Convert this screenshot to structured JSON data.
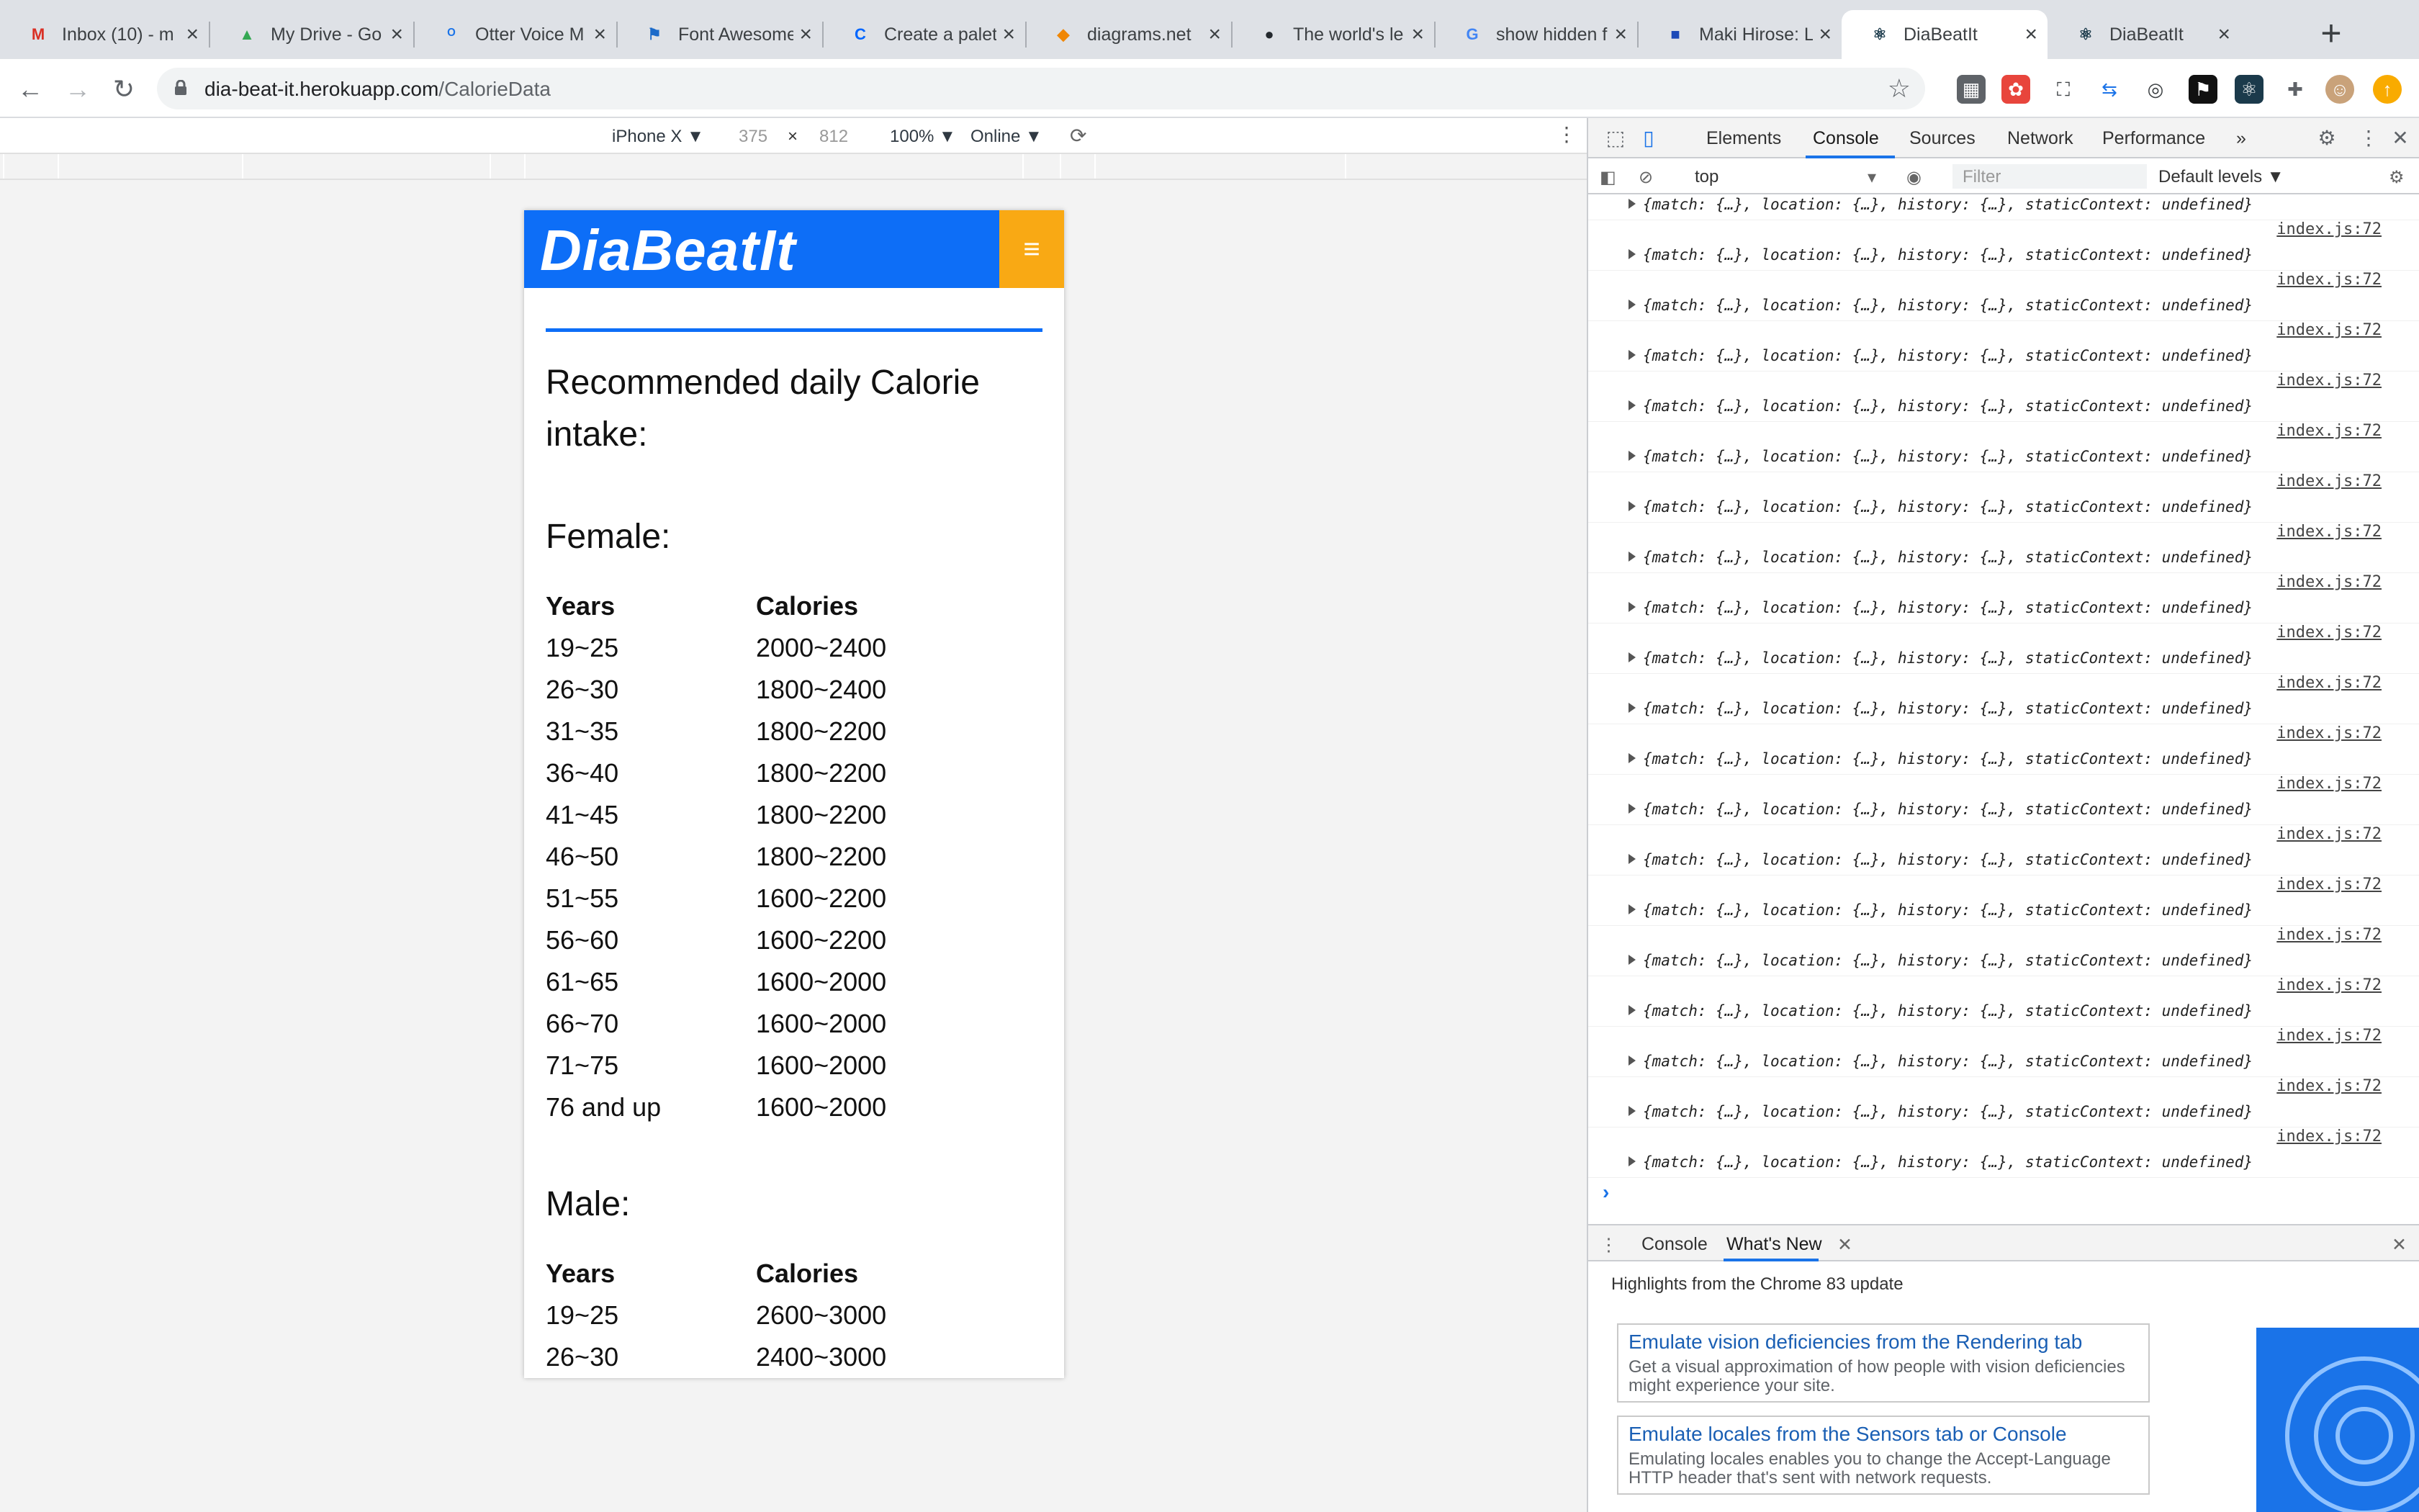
{
  "tabs": [
    {
      "title": "Inbox (10) - m",
      "icon": "gmail-icon",
      "color": "#d93025",
      "glyph": "M"
    },
    {
      "title": "My Drive - Go",
      "icon": "drive-icon",
      "color": "#34a853",
      "glyph": "▲"
    },
    {
      "title": "Otter Voice M",
      "icon": "otter-icon",
      "color": "#1a73e8",
      "glyph": "ᴼ"
    },
    {
      "title": "Font Awesome",
      "icon": "flag-icon",
      "color": "#1b6ac9",
      "glyph": "⚑"
    },
    {
      "title": "Create a palet",
      "icon": "coolors-icon",
      "color": "#0066ff",
      "glyph": "C"
    },
    {
      "title": "diagrams.net",
      "icon": "diagrams-icon",
      "color": "#f08705",
      "glyph": "◆"
    },
    {
      "title": "The world's le",
      "icon": "github-icon",
      "color": "#24292e",
      "glyph": "●"
    },
    {
      "title": "show hidden f",
      "icon": "google-icon",
      "color": "#4285f4",
      "glyph": "G"
    },
    {
      "title": "Maki Hirose: L",
      "icon": "doc-icon",
      "color": "#1c4ab8",
      "glyph": "■"
    },
    {
      "title": "DiaBeatIt",
      "icon": "react-icon",
      "color": "#1b3a4b",
      "glyph": "⚛"
    },
    {
      "title": "DiaBeatIt",
      "icon": "react-icon",
      "color": "#1b3a4b",
      "glyph": "⚛"
    }
  ],
  "active_tab": 9,
  "url": {
    "host": "dia-beat-it.herokuapp.com",
    "path": "/CalorieData"
  },
  "device_toolbar": {
    "device": "iPhone X ▼",
    "width": "375",
    "times": "×",
    "height": "812",
    "zoom": "100% ▼",
    "network": "Online ▼"
  },
  "app": {
    "logo": "DiaBeatIt",
    "menu_icon": "≡",
    "heading": "Recommended daily Calorie intake:",
    "female": {
      "title": "Female:",
      "headers": [
        "Years",
        "Calories"
      ],
      "rows": [
        [
          "19~25",
          "2000~2400"
        ],
        [
          "26~30",
          "1800~2400"
        ],
        [
          "31~35",
          "1800~2200"
        ],
        [
          "36~40",
          "1800~2200"
        ],
        [
          "41~45",
          "1800~2200"
        ],
        [
          "46~50",
          "1800~2200"
        ],
        [
          "51~55",
          "1600~2200"
        ],
        [
          "56~60",
          "1600~2200"
        ],
        [
          "61~65",
          "1600~2000"
        ],
        [
          "66~70",
          "1600~2000"
        ],
        [
          "71~75",
          "1600~2000"
        ],
        [
          "76 and up",
          "1600~2000"
        ]
      ]
    },
    "male": {
      "title": "Male:",
      "headers": [
        "Years",
        "Calories"
      ],
      "rows": [
        [
          "19~25",
          "2600~3000"
        ],
        [
          "26~30",
          "2400~3000"
        ]
      ]
    }
  },
  "devtools": {
    "tabs": [
      "Elements",
      "Console",
      "Sources",
      "Network",
      "Performance"
    ],
    "more": "»",
    "context": "top",
    "filter_placeholder": "Filter",
    "levels": "Default levels ▼",
    "log_source": "index.js:72",
    "log_message": "{match: {…}, location: {…}, history: {…}, staticContext: undefined}",
    "log_count": 20,
    "prompt": "›",
    "drawer_tabs": [
      "Console",
      "What's New"
    ],
    "whats_new_heading": "Highlights from the Chrome 83 update",
    "cards": [
      {
        "title": "Emulate vision deficiencies from the Rendering tab",
        "desc": "Get a visual approximation of how people with vision deficiencies might experience your site."
      },
      {
        "title": "Emulate locales from the Sensors tab or Console",
        "desc": "Emulating locales enables you to change the Accept-Language HTTP header that's sent with network requests."
      }
    ]
  }
}
